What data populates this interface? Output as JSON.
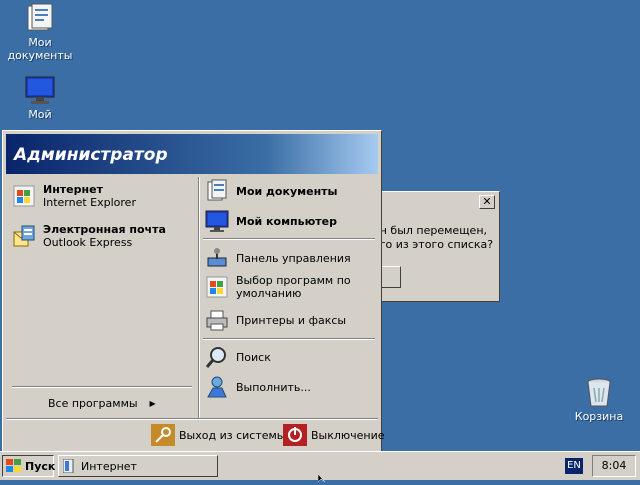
{
  "desktop": {
    "icons": [
      {
        "label": "Мои документы",
        "icon": "my-documents-icon"
      },
      {
        "label": "Мой",
        "icon": "my-computer-icon"
      },
      {
        "label": "Корзина",
        "icon": "recycle-bin-icon"
      }
    ]
  },
  "dialog": {
    "close_glyph": "✕",
    "message_line1": "он был перемещен,",
    "message_line2": "его из этого списка?"
  },
  "start_menu": {
    "user_name": "Администратор",
    "pinned": [
      {
        "title": "Интернет",
        "subtitle": "Internet Explorer",
        "icon": "internet-explorer-icon"
      },
      {
        "title": "Электронная почта",
        "subtitle": "Outlook Express",
        "icon": "outlook-express-icon"
      }
    ],
    "all_programs": "Все программы",
    "all_programs_arrow": "▶",
    "right": {
      "my_documents": "Мои документы",
      "my_computer": "Мой компьютер",
      "control_panel": "Панель управления",
      "default_programs_1": "Выбор программ по",
      "default_programs_2": "умолчанию",
      "printers": "Принтеры и факсы",
      "search": "Поиск",
      "run": "Выполнить..."
    },
    "logoff": "Выход из системы",
    "shutdown": "Выключение"
  },
  "taskbar": {
    "start_label": "Пуск",
    "task_label": "Интернет",
    "language": "EN",
    "clock": "8:04"
  },
  "colors": {
    "desktop": "#3a6ea5",
    "header_dark": "#0a246a",
    "face": "#d4d0c8"
  }
}
